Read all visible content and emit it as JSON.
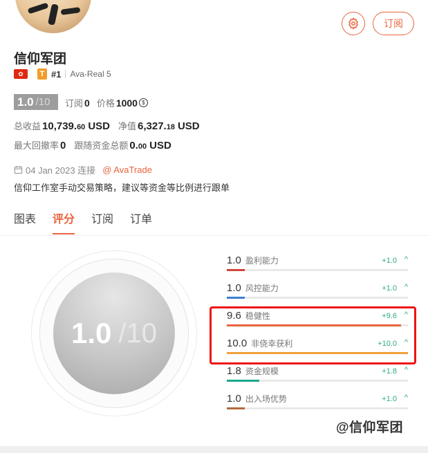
{
  "header": {
    "subscribe_label": "订阅",
    "gear_icon": "gear-icon",
    "accent_color": "#e8643c"
  },
  "profile": {
    "name": "信仰军团",
    "flag": "HK",
    "tier_badge": "T",
    "rank": "#1",
    "account": "Ava-Real 5",
    "score": "1.0",
    "score_denominator": "/10",
    "subscribe_label": "订阅",
    "subscribe_count": "0",
    "price_label": "价格",
    "price_value": "1000",
    "total_return_label": "总收益",
    "total_return_main": "10,739.",
    "total_return_small": "60",
    "total_return_unit": "USD",
    "net_value_label": "净值",
    "net_value_main": "6,327.",
    "net_value_small": "18",
    "net_value_unit": "USD",
    "max_drawdown_label": "最大回撤率",
    "max_drawdown_value": "0",
    "follow_funds_label": "跟随资金总额",
    "follow_funds_main": "0.",
    "follow_funds_small": "00",
    "follow_funds_unit": "USD",
    "connect_date": "04 Jan 2023 连接",
    "broker": "@ AvaTrade",
    "description": "信仰工作室手动交易策略，建议等资金等比例进行跟单"
  },
  "tabs": [
    {
      "label": "图表"
    },
    {
      "label": "评分"
    },
    {
      "label": "订阅"
    },
    {
      "label": "订单"
    }
  ],
  "gauge": {
    "score": "1.0",
    "slash": "/10"
  },
  "metrics": [
    {
      "value": "1.0",
      "label": "盈利能力",
      "delta": "+1.0",
      "fraction": 0.1,
      "color": "#d0453a"
    },
    {
      "value": "1.0",
      "label": "风控能力",
      "delta": "+1.0",
      "fraction": 0.1,
      "color": "#3b7fd1"
    },
    {
      "value": "9.6",
      "label": "稳健性",
      "delta": "+9.6",
      "fraction": 0.96,
      "color": "#e8643c"
    },
    {
      "value": "10.0",
      "label": "非侥幸获利",
      "delta": "+10.0",
      "fraction": 1.0,
      "color": "#efa13a"
    },
    {
      "value": "1.8",
      "label": "资金规模",
      "delta": "+1.8",
      "fraction": 0.18,
      "color": "#1aa88a"
    },
    {
      "value": "1.0",
      "label": "出入场优势",
      "delta": "+1.0",
      "fraction": 0.1,
      "color": "#b26a3a"
    }
  ],
  "watermark": "@信仰军团"
}
